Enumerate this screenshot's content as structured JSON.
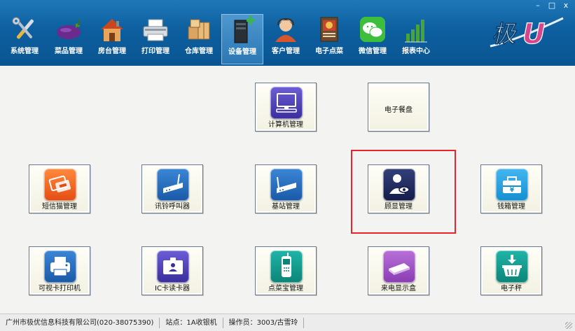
{
  "window": {
    "minimize": "–",
    "maximize": "□",
    "close": "x"
  },
  "toolbar": [
    {
      "id": "system",
      "label": "系统管理",
      "icon": "wrench-screwdriver-icon"
    },
    {
      "id": "dishes",
      "label": "菜品管理",
      "icon": "eggplant-icon"
    },
    {
      "id": "rooms",
      "label": "房台管理",
      "icon": "house-icon"
    },
    {
      "id": "print",
      "label": "打印管理",
      "icon": "printer-icon"
    },
    {
      "id": "storage",
      "label": "仓库管理",
      "icon": "boxes-icon"
    },
    {
      "id": "devices",
      "label": "设备管理",
      "icon": "server-add-icon",
      "active": true
    },
    {
      "id": "customer",
      "label": "客户管理",
      "icon": "customer-icon"
    },
    {
      "id": "emenu",
      "label": "电子点菜",
      "icon": "picture-menu-icon"
    },
    {
      "id": "wechat",
      "label": "微信管理",
      "icon": "wechat-icon"
    },
    {
      "id": "reports",
      "label": "报表中心",
      "icon": "bar-chart-icon"
    }
  ],
  "logo": {
    "text": "极U"
  },
  "tiles": {
    "computer": {
      "label": "计算机管理",
      "icon": "monitor-icon"
    },
    "eplate": {
      "label": "电子餐盘"
    },
    "sms": {
      "label": "短信猫管理",
      "icon": "sms-card-icon"
    },
    "pager": {
      "label": "讯铃呼叫器",
      "icon": "router-icon"
    },
    "basestation": {
      "label": "基站管理",
      "icon": "base-station-icon"
    },
    "display": {
      "label": "顾显管理",
      "icon": "customer-display-icon"
    },
    "cashbox": {
      "label": "钱箱管理",
      "icon": "cash-box-icon"
    },
    "cardprinter": {
      "label": "可视卡打印机",
      "icon": "card-printer-icon"
    },
    "icreader": {
      "label": "IC卡读卡器",
      "icon": "id-card-icon"
    },
    "ordering": {
      "label": "点菜宝管理",
      "icon": "handheld-icon"
    },
    "callerid": {
      "label": "来电显示盒",
      "icon": "caller-id-box-icon"
    },
    "scale": {
      "label": "电子秤",
      "icon": "scale-basket-icon"
    }
  },
  "status": {
    "company": "广州市极优信息科技有限公司(020-38075390)",
    "station": "站点：1A收银机",
    "operator": "操作员：3003/古雪玲"
  },
  "colors": {
    "header": "#0d5f9f",
    "highlight": "#e8232b"
  }
}
